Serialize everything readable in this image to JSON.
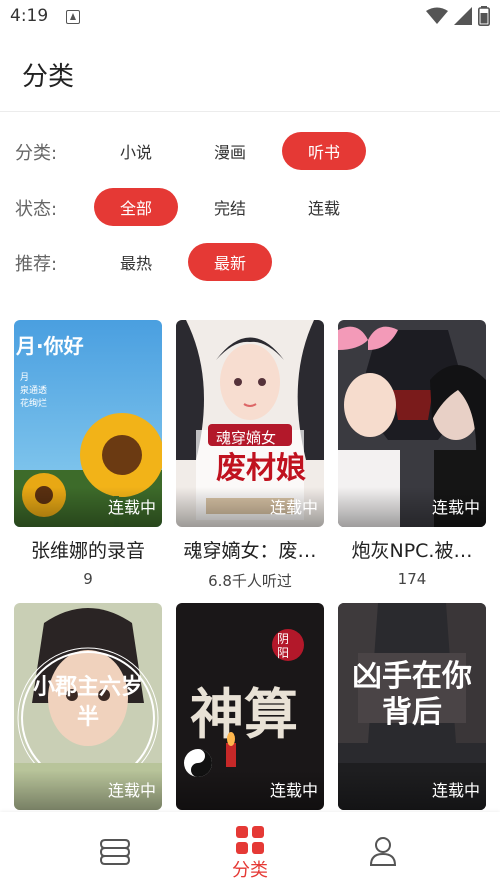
{
  "status_bar": {
    "time": "4:19"
  },
  "header": {
    "title": "分类"
  },
  "filters": [
    {
      "label": "分类:",
      "options": [
        "小说",
        "漫画",
        "听书"
      ],
      "selected": "听书"
    },
    {
      "label": "状态:",
      "options": [
        "全部",
        "完结",
        "连载"
      ],
      "selected": "全部"
    },
    {
      "label": "推荐:",
      "options": [
        "最热",
        "最新"
      ],
      "selected": "最新"
    }
  ],
  "items": [
    {
      "title": "张维娜的录音",
      "meta": "9",
      "status": "连载中",
      "cover_text": "月·你好"
    },
    {
      "title": "魂穿嫡女：废…",
      "meta": "6.8千人听过",
      "status": "连载中",
      "cover_text": "魂穿嫡女"
    },
    {
      "title": "炮灰NPC.被…",
      "meta": "174",
      "status": "连载中",
      "cover_text": ""
    },
    {
      "title": "",
      "meta": "",
      "status": "连载中",
      "cover_text": "小郡主六岁半"
    },
    {
      "title": "",
      "meta": "",
      "status": "连载中",
      "cover_text": "神算"
    },
    {
      "title": "",
      "meta": "",
      "status": "连载中",
      "cover_text": "凶手在你背后"
    }
  ],
  "tabbar": {
    "tabs": [
      {
        "icon": "bookshelf-icon",
        "label": ""
      },
      {
        "icon": "category-grid-icon",
        "label": "分类",
        "active": true
      },
      {
        "icon": "person-icon",
        "label": ""
      }
    ]
  },
  "colors": {
    "accent": "#e53935"
  }
}
